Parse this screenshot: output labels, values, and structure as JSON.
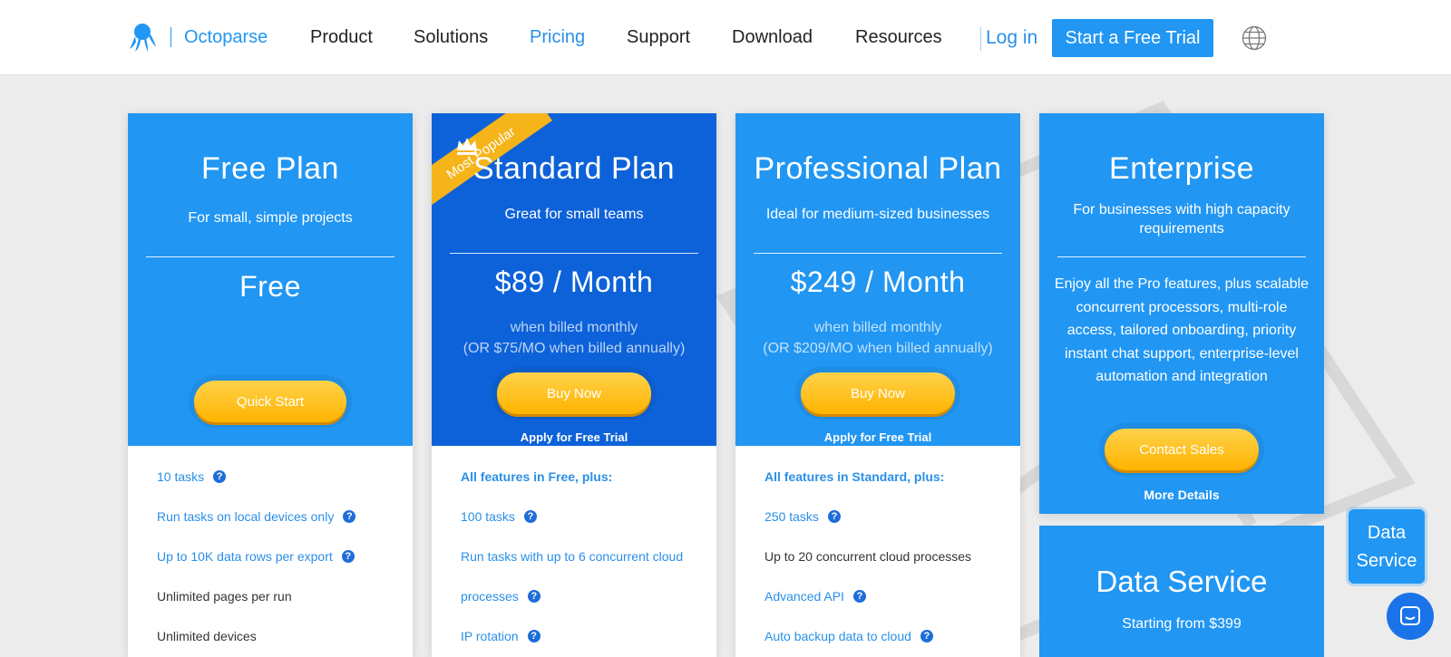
{
  "header": {
    "brand": "Octoparse",
    "nav": [
      "Product",
      "Solutions",
      "Pricing",
      "Support",
      "Download",
      "Resources"
    ],
    "active_nav": "Pricing",
    "login": "Log in",
    "trial_button": "Start a Free Trial"
  },
  "plans": {
    "free": {
      "title": "Free Plan",
      "subtitle": "For small, simple projects",
      "price": "Free",
      "button": "Quick Start",
      "features": [
        "10 tasks",
        "Run tasks on local devices only",
        "Up to 10K data rows per export",
        "Unlimited pages per run",
        "Unlimited devices"
      ]
    },
    "standard": {
      "ribbon": "Most Popular",
      "title": "Standard Plan",
      "subtitle": "Great for small teams",
      "price": "$89 / Month",
      "billing_1": "when billed monthly",
      "billing_2": "(OR $75/MO when billed annually)",
      "button": "Buy Now",
      "apply": "Apply for Free Trial",
      "features": [
        "All features in Free, plus:",
        "100 tasks",
        "Run tasks with up to 6 concurrent cloud",
        "processes",
        "IP rotation"
      ]
    },
    "professional": {
      "title": "Professional Plan",
      "subtitle": "Ideal for medium-sized businesses",
      "price": "$249 / Month",
      "billing_1": "when billed monthly",
      "billing_2": "(OR $209/MO when billed annually)",
      "button": "Buy Now",
      "apply": "Apply for Free Trial",
      "features": [
        "All features in Standard, plus:",
        "250 tasks",
        "Up to 20 concurrent cloud processes",
        "Advanced API",
        "Auto backup data to cloud"
      ]
    },
    "enterprise": {
      "title": "Enterprise",
      "subtitle": "For businesses with high capacity requirements",
      "description": "Enjoy all the Pro features, plus scalable concurrent processors, multi-role access, tailored onboarding, priority instant chat support, enterprise-level automation and integration",
      "button": "Contact Sales",
      "more": "More Details"
    },
    "data_service": {
      "title": "Data Service",
      "subtitle": "Starting from $399"
    }
  },
  "floating": {
    "data_service": "Data Service"
  },
  "colors": {
    "primary": "#2196f3",
    "standard_dark": "#0d62d9",
    "button_yellow": "#ffbf1f"
  },
  "icons": [
    "octopus-logo-icon",
    "globe-icon",
    "help-icon",
    "crown-icon",
    "chat-icon"
  ]
}
